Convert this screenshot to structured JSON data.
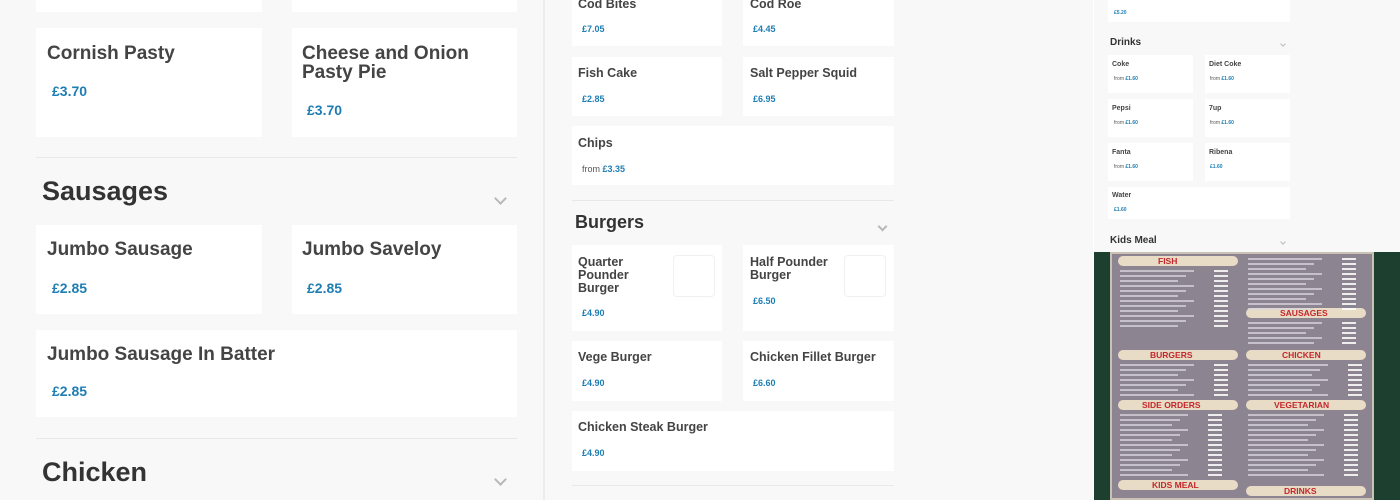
{
  "left_panel": {
    "pies_cards": [
      {
        "name": "Cornish Pasty",
        "price": "£3.70"
      },
      {
        "name_line1": "Cheese and Onion",
        "name_line2": "Pasty Pie",
        "price": "£3.70"
      }
    ],
    "sausages": {
      "title": "Sausages",
      "items": [
        {
          "name": "Jumbo Sausage",
          "price": "£2.85"
        },
        {
          "name": "Jumbo Saveloy",
          "price": "£2.85"
        },
        {
          "name": "Jumbo Sausage In Batter",
          "price": "£2.85"
        }
      ]
    },
    "chicken": {
      "title": "Chicken"
    }
  },
  "middle_panel": {
    "fish_items": [
      {
        "name": "Cod Bites",
        "price": "£7.05"
      },
      {
        "name": "Cod Roe",
        "price": "£4.45"
      },
      {
        "name": "Fish Cake",
        "price": "£2.85"
      },
      {
        "name": "Salt Pepper Squid",
        "price": "£6.95"
      },
      {
        "name": "Chips",
        "from": "from",
        "price": "£3.35"
      }
    ],
    "burgers": {
      "title": "Burgers",
      "items": [
        {
          "line1": "Quarter",
          "line2": "Pounder",
          "line3": "Burger",
          "price": "£4.90"
        },
        {
          "line1": "Half Pounder",
          "line2": "Burger",
          "price": "£6.50"
        },
        {
          "name": "Vege Burger",
          "price": "£4.90"
        },
        {
          "name": "Chicken Fillet Burger",
          "price": "£6.60"
        },
        {
          "name": "Chicken Steak Burger",
          "price": "£4.90"
        }
      ]
    }
  },
  "right_panel": {
    "top_price": "£5.20",
    "drinks": {
      "title": "Drinks",
      "items": [
        {
          "name": "Coke",
          "from": "from",
          "price": "£1.60"
        },
        {
          "name": "Diet Coke",
          "from": "from",
          "price": "£1.60"
        },
        {
          "name": "Pepsi",
          "from": "from",
          "price": "£1.60"
        },
        {
          "name": "7up",
          "from": "from",
          "price": "£1.60"
        },
        {
          "name": "Fanta",
          "from": "from",
          "price": "£1.60"
        },
        {
          "name": "Ribena",
          "price": "£1.60"
        },
        {
          "name": "Water",
          "price": "£1.60"
        }
      ]
    },
    "kids_meal": {
      "title": "Kids Meal"
    }
  },
  "menu_board_photo": {
    "sections": [
      "FISH",
      "SAUSAGES",
      "BURGERS",
      "CHICKEN",
      "SIDE ORDERS",
      "VEGETARIAN",
      "KIDS MEAL",
      "DRINKS"
    ]
  },
  "colors": {
    "price_blue": "#1e7eb3",
    "panel_bg": "#f8f8f8",
    "card_bg": "#ffffff",
    "board_band": "#e8dcc6",
    "board_heading_red": "#c4262b"
  }
}
